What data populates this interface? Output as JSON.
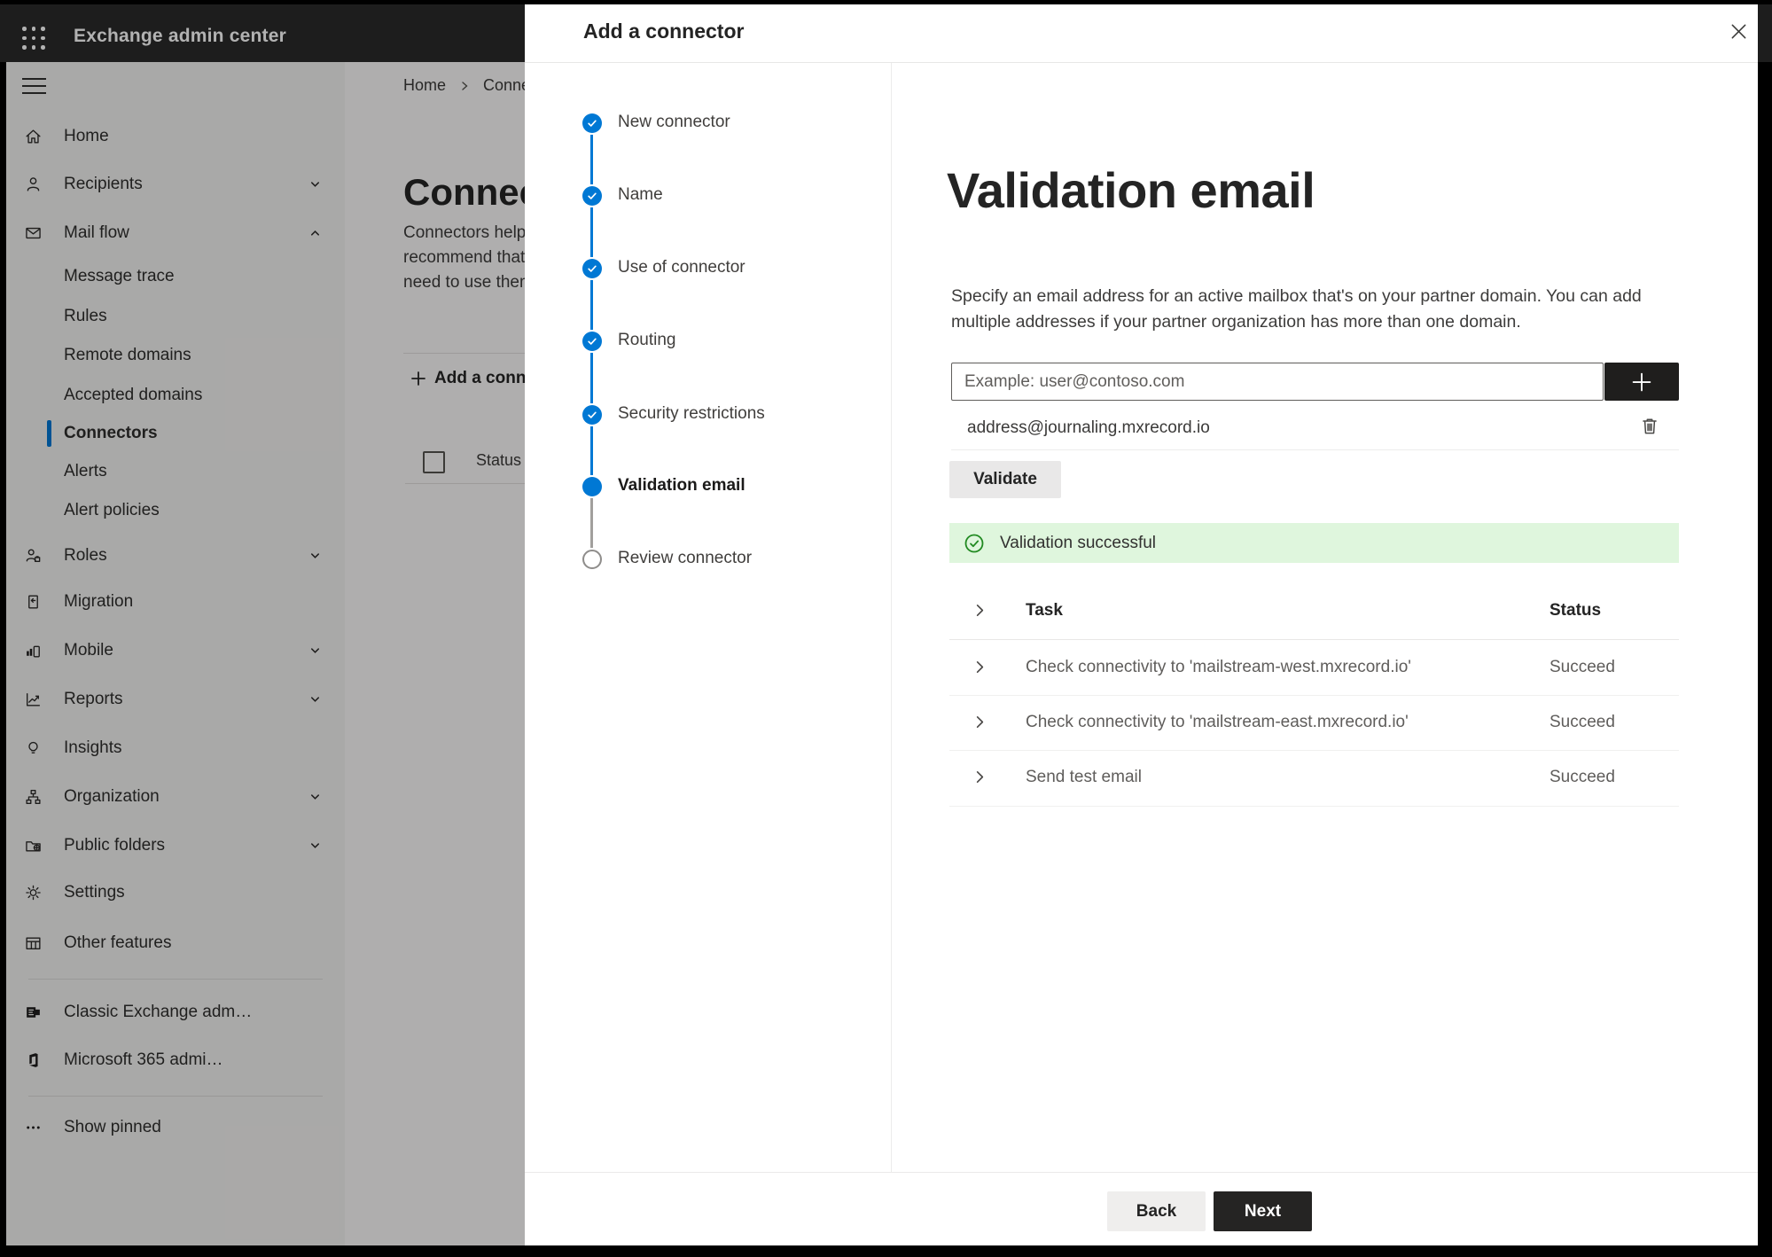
{
  "colors": {
    "accent": "#0078d4",
    "success": "#107c10",
    "success_banner_bg": "#dff6dd",
    "primary_button": "#252423"
  },
  "top_bar": {
    "title": "Exchange admin center"
  },
  "sidebar": {
    "items": [
      {
        "label": "Home",
        "icon": "home"
      },
      {
        "label": "Recipients",
        "icon": "person",
        "chevron": "down"
      },
      {
        "label": "Mail flow",
        "icon": "mail",
        "chevron": "up"
      },
      {
        "label": "Message trace",
        "sub": true
      },
      {
        "label": "Rules",
        "sub": true
      },
      {
        "label": "Remote domains",
        "sub": true
      },
      {
        "label": "Accepted domains",
        "sub": true
      },
      {
        "label": "Connectors",
        "sub": true,
        "selected": true
      },
      {
        "label": "Alerts",
        "sub": true
      },
      {
        "label": "Alert policies",
        "sub": true
      },
      {
        "label": "Roles",
        "icon": "roles",
        "chevron": "down"
      },
      {
        "label": "Migration",
        "icon": "migration"
      },
      {
        "label": "Mobile",
        "icon": "mobile",
        "chevron": "down"
      },
      {
        "label": "Reports",
        "icon": "reports",
        "chevron": "down"
      },
      {
        "label": "Insights",
        "icon": "lightbulb"
      },
      {
        "label": "Organization",
        "icon": "org-chart",
        "chevron": "down"
      },
      {
        "label": "Public folders",
        "icon": "folder-globe",
        "chevron": "down"
      },
      {
        "label": "Settings",
        "icon": "gear"
      },
      {
        "label": "Other features",
        "icon": "table"
      }
    ],
    "footer_items": [
      {
        "label": "Classic Exchange adm…",
        "icon": "exchange-logo"
      },
      {
        "label": "Microsoft 365 admi…",
        "icon": "microsoft-365-logo"
      }
    ],
    "show_pinned": {
      "label": "Show pinned",
      "icon": "ellipsis"
    }
  },
  "page": {
    "breadcrumb": {
      "home": "Home",
      "current": "Connectors"
    },
    "title": "Connectors",
    "description_lines": [
      "Connectors help your mail flow when",
      "recommend that you create connect",
      "need to use them. Learn more"
    ],
    "add_button": "Add a connector",
    "column_header": "Status"
  },
  "wizard": {
    "title": "Add a connector",
    "steps": [
      {
        "label": "New connector",
        "state": "complete"
      },
      {
        "label": "Name",
        "state": "complete"
      },
      {
        "label": "Use of connector",
        "state": "complete"
      },
      {
        "label": "Routing",
        "state": "complete"
      },
      {
        "label": "Security restrictions",
        "state": "complete"
      },
      {
        "label": "Validation email",
        "state": "active"
      },
      {
        "label": "Review connector",
        "state": "upcoming"
      }
    ]
  },
  "content": {
    "heading": "Validation email",
    "description_lines": [
      "Specify an email address for an active mailbox that's on your partner domain. You can add",
      "multiple addresses if your partner organization has more than one domain."
    ],
    "input_placeholder": "Example: user@contoso.com",
    "added_address": "address@journaling.mxrecord.io",
    "validate_button": "Validate",
    "banner_text": "Validation successful",
    "table": {
      "columns": {
        "task": "Task",
        "status": "Status"
      },
      "rows": [
        {
          "task": "Check connectivity to 'mailstream-west.mxrecord.io'",
          "status": "Succeed"
        },
        {
          "task": "Check connectivity to 'mailstream-east.mxrecord.io'",
          "status": "Succeed"
        },
        {
          "task": "Send test email",
          "status": "Succeed"
        }
      ]
    }
  },
  "footer": {
    "back": "Back",
    "next": "Next"
  }
}
